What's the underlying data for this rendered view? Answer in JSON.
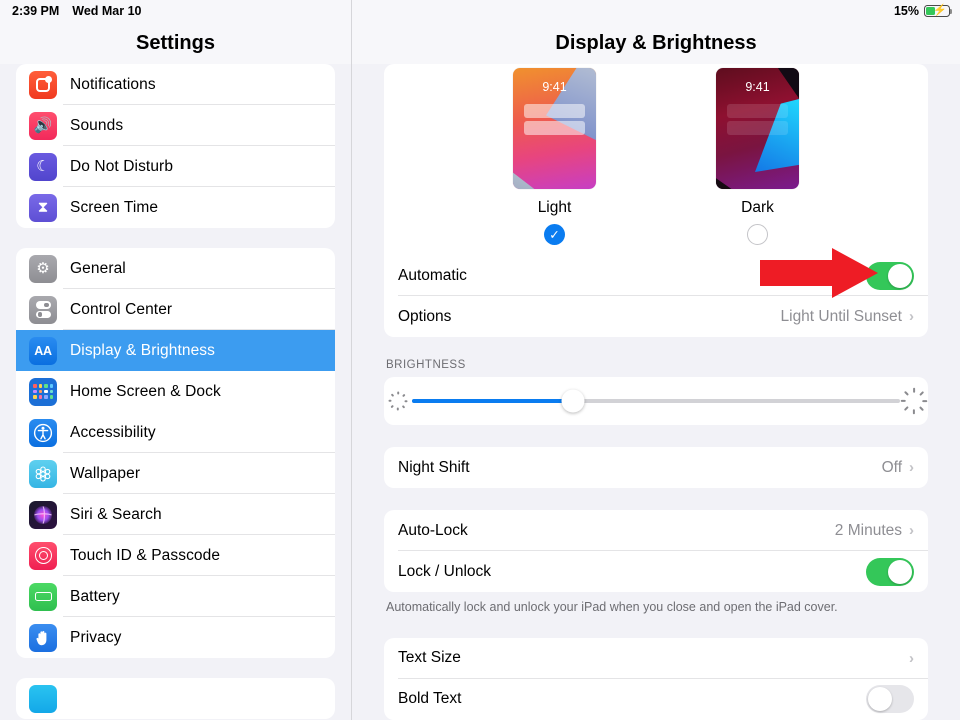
{
  "status_bar": {
    "time": "2:39 PM",
    "date": "Wed Mar 10",
    "battery_percent": "15%",
    "battery_charging": true,
    "battery_icon": "battery-charging-icon"
  },
  "sidebar": {
    "title": "Settings",
    "groups": [
      {
        "items": [
          {
            "label": "Notifications",
            "icon": "notifications-icon"
          },
          {
            "label": "Sounds",
            "icon": "sounds-icon"
          },
          {
            "label": "Do Not Disturb",
            "icon": "do-not-disturb-icon"
          },
          {
            "label": "Screen Time",
            "icon": "screen-time-icon"
          }
        ]
      },
      {
        "items": [
          {
            "label": "General",
            "icon": "general-gear-icon"
          },
          {
            "label": "Control Center",
            "icon": "control-center-icon"
          },
          {
            "label": "Display & Brightness",
            "icon": "display-brightness-icon",
            "selected": true
          },
          {
            "label": "Home Screen & Dock",
            "icon": "home-screen-dock-icon"
          },
          {
            "label": "Accessibility",
            "icon": "accessibility-icon"
          },
          {
            "label": "Wallpaper",
            "icon": "wallpaper-icon"
          },
          {
            "label": "Siri & Search",
            "icon": "siri-search-icon"
          },
          {
            "label": "Touch ID & Passcode",
            "icon": "touch-id-passcode-icon"
          },
          {
            "label": "Battery",
            "icon": "battery-icon"
          },
          {
            "label": "Privacy",
            "icon": "privacy-hand-icon"
          }
        ]
      }
    ]
  },
  "detail": {
    "title": "Display & Brightness",
    "appearance": {
      "light": {
        "name": "Light",
        "preview_time": "9:41",
        "selected": true,
        "checkmark": "✓"
      },
      "dark": {
        "name": "Dark",
        "preview_time": "9:41",
        "selected": false
      }
    },
    "automatic_row": {
      "label": "Automatic",
      "toggle_on": true
    },
    "options_row": {
      "label": "Options",
      "value": "Light Until Sunset",
      "chevron": "›"
    },
    "brightness": {
      "header": "BRIGHTNESS",
      "value_percent": 33,
      "low_icon": "sun-low-icon",
      "high_icon": "sun-high-icon"
    },
    "night_shift_row": {
      "label": "Night Shift",
      "value": "Off",
      "chevron": "›"
    },
    "auto_lock_row": {
      "label": "Auto-Lock",
      "value": "2 Minutes",
      "chevron": "›"
    },
    "lock_unlock_row": {
      "label": "Lock / Unlock",
      "toggle_on": true
    },
    "lock_unlock_footnote": "Automatically lock and unlock your iPad when you close and open the iPad cover.",
    "text_size_row": {
      "label": "Text Size",
      "chevron": "›"
    },
    "bold_text_row": {
      "label": "Bold Text",
      "toggle_on": false
    }
  },
  "annotation": {
    "arrow": {
      "name": "red-pointer-arrow",
      "color": "#ee1c25",
      "points_to": "automatic-toggle"
    }
  },
  "colors": {
    "accent_blue": "#0a7cf0",
    "toggle_green": "#34c759",
    "selected_row_blue": "#3c9cf0",
    "group_background": "#f2f2f7"
  }
}
